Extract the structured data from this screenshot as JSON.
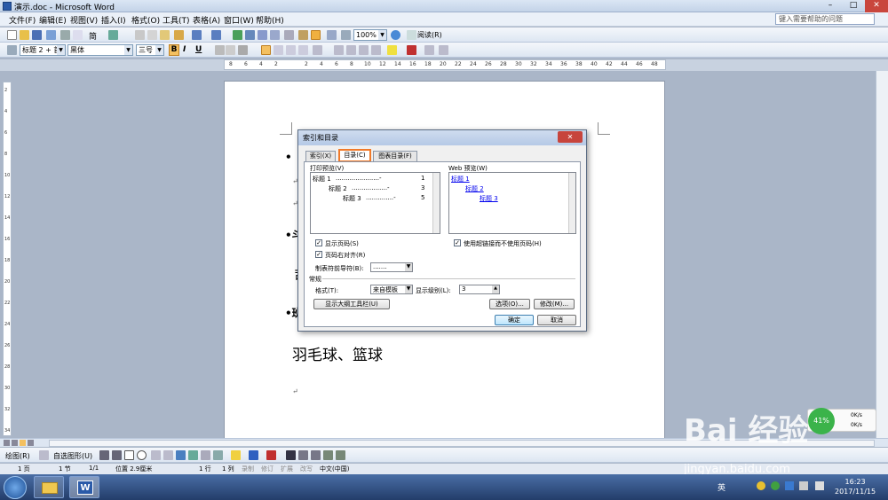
{
  "window": {
    "title": "演示.doc - Microsoft Word",
    "min": "–",
    "max": "□",
    "close": "✕"
  },
  "menus": [
    "文件(F)",
    "编辑(E)",
    "视图(V)",
    "插入(I)",
    "格式(O)",
    "工具(T)",
    "表格(A)",
    "窗口(W)",
    "帮助(H)"
  ],
  "help_box": {
    "placeholder": "键入需要帮助的问题"
  },
  "toolbar1": {
    "zoom": "100%",
    "read_label": "阅读(R)",
    "simp": "简"
  },
  "toolbar2": {
    "style": "标题 2 + 首",
    "font": "黑体",
    "size": "三号",
    "bold": "B",
    "italic": "I",
    "underline": "U"
  },
  "ruler_ticks": [
    "8",
    "6",
    "4",
    "2",
    "",
    "2",
    "4",
    "6",
    "8",
    "10",
    "12",
    "14",
    "16",
    "18",
    "20",
    "22",
    "24",
    "26",
    "28",
    "30",
    "32",
    "34",
    "36",
    "38",
    "40",
    "42",
    "44",
    "46",
    "48"
  ],
  "vruler_ticks": [
    "2",
    "4",
    "6",
    "8",
    "10",
    "12",
    "14",
    "16",
    "18",
    "20",
    "22",
    "24",
    "26",
    "28",
    "30",
    "32",
    "34"
  ],
  "document": {
    "text_line": "羽毛球、篮球",
    "para_marks": [
      "↵",
      "↵",
      "↵"
    ],
    "bullets": [
      "•",
      "•斗",
      "•",
      "•班"
    ],
    "partial": "司"
  },
  "dialog": {
    "title": "索引和目录",
    "close": "✕",
    "tabs": {
      "index": "索引(X)",
      "toc": "目录(C)",
      "figures": "图表目录(F)"
    },
    "print_preview_label": "打印预览(V)",
    "print_preview": [
      {
        "text": "标题 1",
        "page": "1"
      },
      {
        "text": "标题 2",
        "page": "3"
      },
      {
        "text": "标题 3",
        "page": "5"
      }
    ],
    "web_preview_label": "Web 预览(W)",
    "web_preview": [
      "标题 1",
      "标题 2",
      "标题 3"
    ],
    "show_page_numbers": "显示页码(S)",
    "right_align": "页码右对齐(R)",
    "use_hyperlinks": "使用超链接而不使用页码(H)",
    "tab_leader_label": "制表符前导符(B):",
    "tab_leader_value": ".......",
    "general_label": "常规",
    "format_label": "格式(T):",
    "format_value": "来自模板",
    "levels_label": "显示级别(L):",
    "levels_value": "3",
    "outline_btn": "显示大纲工具栏(U)",
    "options_btn": "选项(O)...",
    "modify_btn": "修改(M)...",
    "ok_btn": "确定",
    "cancel_btn": "取消"
  },
  "drawbar": {
    "draw_label": "绘图(R)",
    "autoshapes": "自选图形(U)"
  },
  "status": {
    "page": "1 页",
    "section": "1 节",
    "pages": "1/1",
    "pos": "位置 2.9厘米",
    "line": "1 行",
    "col": "1 列",
    "rec": "录制",
    "trk": "修订",
    "ext": "扩展",
    "ovr": "改写",
    "lang": "中文(中国)"
  },
  "taskbar": {
    "time": "16:23",
    "date": "2017/11/15",
    "ime": "英"
  },
  "net_widget": {
    "percent": "41%",
    "up": "0K/s",
    "down": "0K/s"
  },
  "watermark": {
    "logo": "Bai 经验",
    "url": "jingyan.baidu.com"
  }
}
